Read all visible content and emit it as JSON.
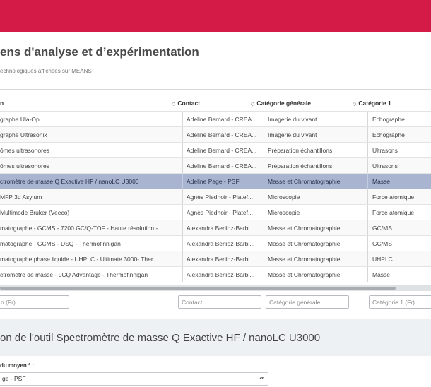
{
  "page": {
    "title": "ens d'analyse et d’expérimentation",
    "subtitle": "echnologiques affichées sur MEANS"
  },
  "table": {
    "headers": [
      "n",
      "Contact",
      "Catégorie générale",
      "Catégorie 1"
    ],
    "sort_glyph": "◇",
    "rows": [
      [
        "graphe Ula-Op",
        "Adeline Bernard - CREA...",
        "Imagerie du vivant",
        "Echographe"
      ],
      [
        "graphe Ultrasonix",
        "Adeline Bernard - CREA...",
        "Imagerie du vivant",
        "Echographe"
      ],
      [
        "ômes ultrasonores",
        "Adeline Bernard - CREA...",
        "Préparation échantillons",
        "Ultrasons"
      ],
      [
        "ômes ultrasonores",
        "Adeline Bernard - CREA...",
        "Préparation échantillons",
        "Ultrasons"
      ],
      [
        "ctromètre de masse Q Exactive HF / nanoLC U3000",
        "Adeline Page - PSF",
        "Masse et Chromatographie",
        "Masse"
      ],
      [
        "MFP 3d Asylum",
        "Agnès Piednoir - Platef...",
        "Microscopie",
        "Force atomique"
      ],
      [
        "Multimode Bruker (Veeco)",
        "Agnès Piednoir - Platef...",
        "Microscopie",
        "Force atomique"
      ],
      [
        "matographe - GCMS - 7200 GC/Q-TOF - Haute résolution - ...",
        "Alexandra Berlioz-Barbi...",
        "Masse et Chromatographie",
        "GC/MS"
      ],
      [
        "matographe - GCMS - DSQ - Thermofinnigan",
        "Alexandra Berlioz-Barbi...",
        "Masse et Chromatographie",
        "GC/MS"
      ],
      [
        "matographe phase liquide - UHPLC - Ultimate 3000- Ther...",
        "Alexandra Berlioz-Barbi...",
        "Masse et Chromatographie",
        "UHPLC"
      ],
      [
        "ctromètre de masse - LCQ Advantage - Thermofinnigan",
        "Alexandra Berlioz-Barbi...",
        "Masse et Chromatographie",
        "Masse"
      ]
    ],
    "selected_row": 4,
    "filters": [
      "n (Fr)",
      "Contact",
      "Catégorie générale",
      "Catégorie 1 (Fr)"
    ]
  },
  "section": {
    "title": "on de l'outil Spectromètre de masse Q Exactive HF / nanoLC U3000",
    "field_label": "du moyen * :",
    "select_value": "ge - PSF",
    "caret": "▴▾"
  },
  "colors": {
    "topbar": "#d41a46",
    "selected_row": "#a8b4d0"
  }
}
